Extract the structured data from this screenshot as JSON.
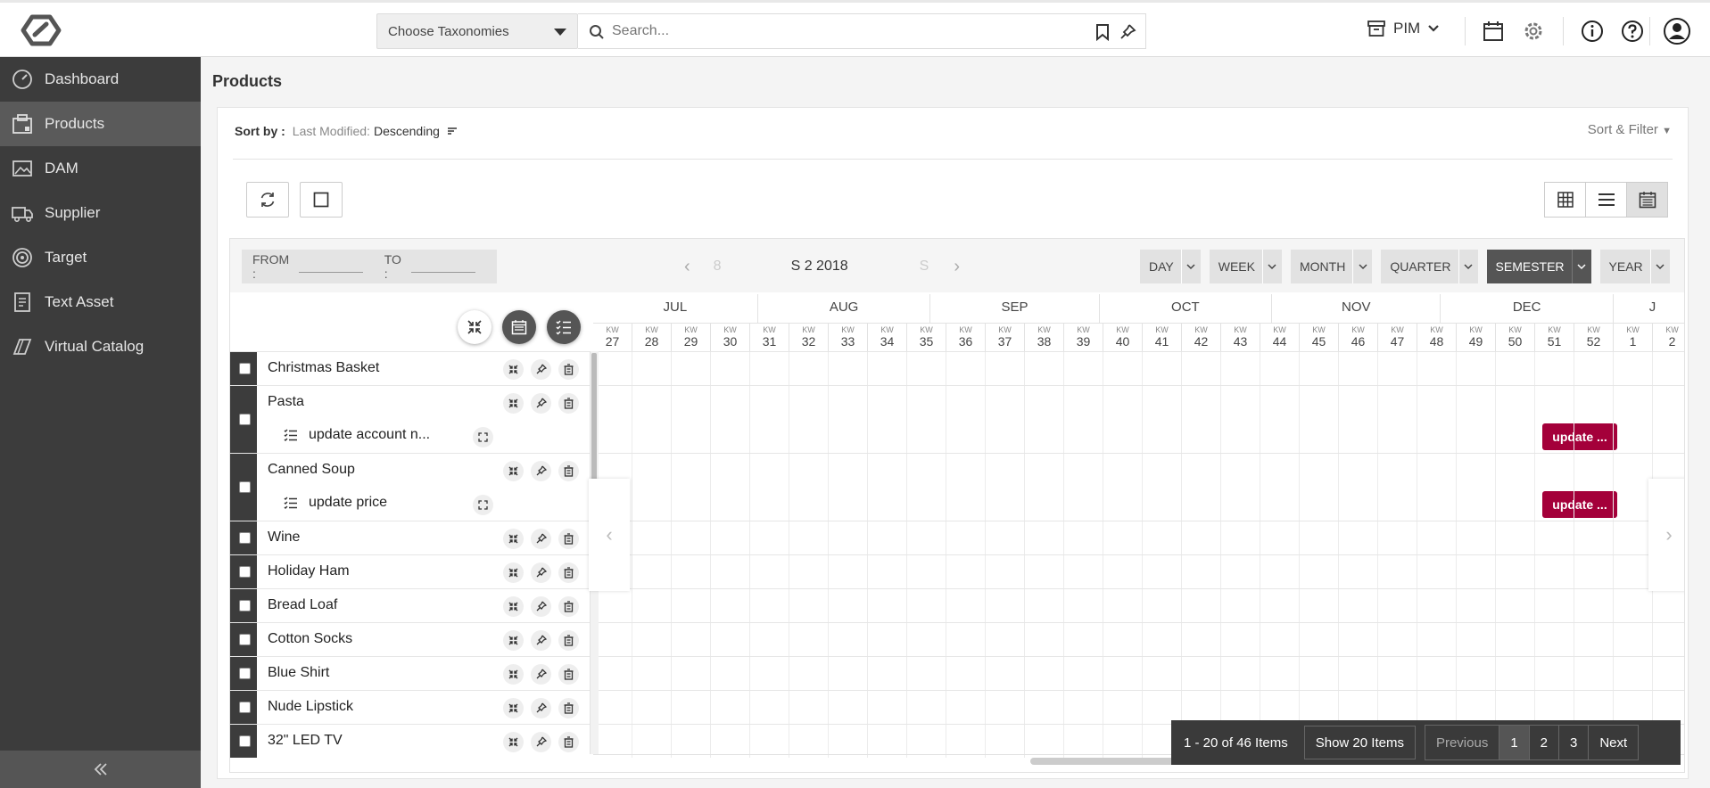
{
  "header": {
    "taxonomy_placeholder": "Choose Taxonomies",
    "search_placeholder": "Search...",
    "workspace": "PIM"
  },
  "sidebar": {
    "items": [
      {
        "label": "Dashboard",
        "icon": "dashboard-icon",
        "active": false
      },
      {
        "label": "Products",
        "icon": "products-icon",
        "active": true
      },
      {
        "label": "DAM",
        "icon": "image-icon",
        "active": false
      },
      {
        "label": "Supplier",
        "icon": "truck-icon",
        "active": false
      },
      {
        "label": "Target",
        "icon": "target-icon",
        "active": false
      },
      {
        "label": "Text Asset",
        "icon": "document-icon",
        "active": false
      },
      {
        "label": "Virtual Catalog",
        "icon": "book-icon",
        "active": false
      }
    ]
  },
  "page": {
    "title": "Products",
    "sort_label": "Sort by :",
    "sort_field": "Last Modified:",
    "sort_order": "Descending",
    "sort_filter": "Sort & Filter"
  },
  "gantt": {
    "from_label": "FROM :",
    "to_label": "TO :",
    "prev_period": "8",
    "period": "S 2 2018",
    "next_period": "S",
    "scales": [
      "DAY",
      "WEEK",
      "MONTH",
      "QUARTER",
      "SEMESTER",
      "YEAR"
    ],
    "active_scale": "SEMESTER",
    "months": [
      "JUL",
      "AUG",
      "SEP",
      "OCT",
      "NOV",
      "DEC",
      "J"
    ],
    "week_prefix": "KW",
    "weeks": [
      "27",
      "28",
      "29",
      "30",
      "31",
      "32",
      "33",
      "34",
      "35",
      "36",
      "37",
      "38",
      "39",
      "40",
      "41",
      "42",
      "43",
      "44",
      "45",
      "46",
      "47",
      "48",
      "49",
      "50",
      "51",
      "52",
      "1",
      "2"
    ],
    "rows": [
      {
        "name": "Christmas Basket"
      },
      {
        "name": "Pasta",
        "task": "update account n...",
        "bar": "update ..."
      },
      {
        "name": "Canned Soup",
        "task": "update price",
        "bar": "update ..."
      },
      {
        "name": "Wine"
      },
      {
        "name": "Holiday Ham"
      },
      {
        "name": "Bread Loaf"
      },
      {
        "name": "Cotton Socks"
      },
      {
        "name": "Blue Shirt"
      },
      {
        "name": "Nude Lipstick"
      },
      {
        "name": "32\" LED TV"
      }
    ],
    "bar_color": "#a4003a"
  },
  "pagination": {
    "summary": "1 - 20 of 46 Items",
    "show": "Show 20 Items",
    "previous": "Previous",
    "pages": [
      "1",
      "2",
      "3"
    ],
    "current": "1",
    "next": "Next"
  }
}
